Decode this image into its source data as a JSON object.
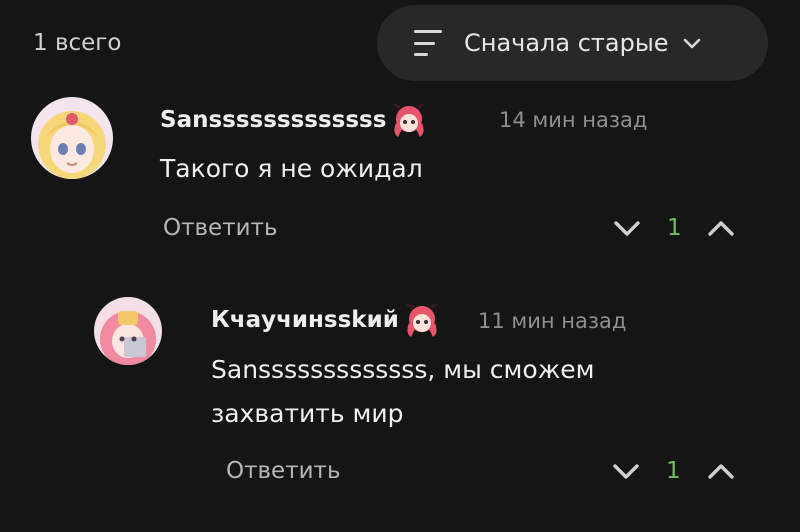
{
  "header": {
    "count_label": "1 всего",
    "sort_label": "Сначала старые"
  },
  "icons": {
    "sort": "sort-lines-icon",
    "chevron": "chevron-down-icon",
    "downvote": "chevron-down-icon",
    "upvote": "chevron-up-icon",
    "badge": "anime-girl-badge-icon"
  },
  "colors": {
    "background": "#151515",
    "sort_pill": "#282828",
    "score": "#6fbf5f",
    "muted": "#8f8f8f"
  },
  "comments": [
    {
      "author": "Sansssssssssssss",
      "time": "14 мин назад",
      "text": "Такого я не ожидал",
      "reply_label": "Ответить",
      "score": "1"
    },
    {
      "author": "Кчаучинsskий",
      "time": "11 мин назад",
      "text_line1": "Sansssssssssssss, мы сможем",
      "text_line2": "захватить мир",
      "reply_label": "Ответить",
      "score": "1"
    }
  ]
}
